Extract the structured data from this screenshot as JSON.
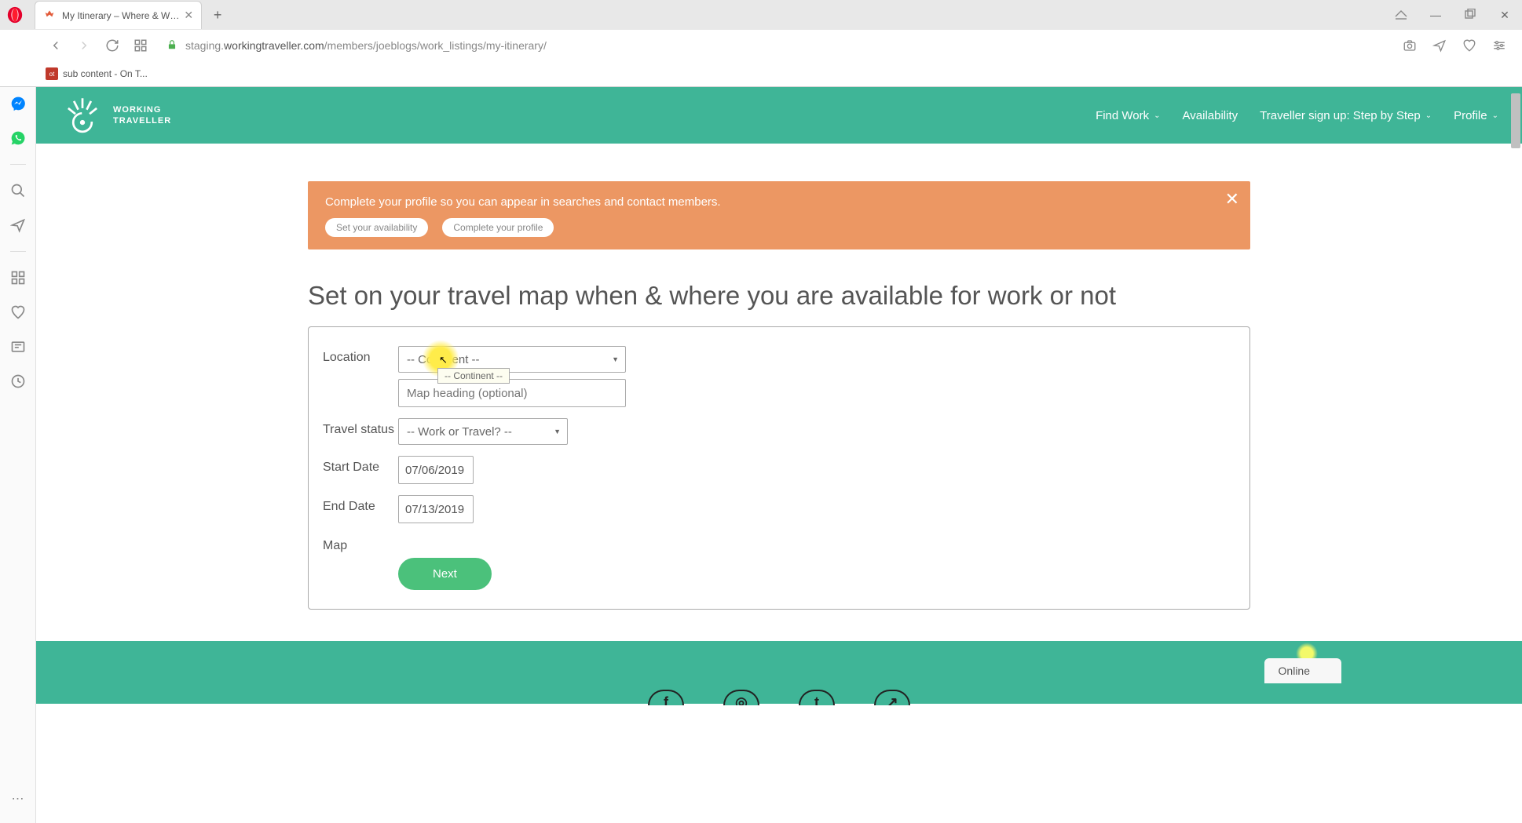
{
  "browser": {
    "tab_title": "My Itinerary – Where & W…",
    "url_prefix": "staging.",
    "url_host": "workingtraveller.com",
    "url_path": "/members/joeblogs/work_listings/my-itinerary/",
    "bookmark": "sub content - On T..."
  },
  "header": {
    "logo_line1": "WORKING",
    "logo_line2": "TRAVELLER",
    "nav": {
      "find_work": "Find Work",
      "availability": "Availability",
      "signup": "Traveller sign up: Step by Step",
      "profile": "Profile"
    }
  },
  "alert": {
    "text": "Complete your profile so you can appear in searches and contact members.",
    "btn1": "Set your availability",
    "btn2": "Complete your profile"
  },
  "heading": "Set on your travel map when & where you are available for work or not",
  "form": {
    "labels": {
      "location": "Location",
      "travel_status": "Travel status",
      "start_date": "Start Date",
      "end_date": "End Date",
      "map": "Map"
    },
    "continent_value": "-- Continent --",
    "continent_tooltip": "-- Continent --",
    "map_heading_placeholder": "Map heading (optional)",
    "travel_status_value": "-- Work or Travel? --",
    "start_date_value": "07/06/2019",
    "end_date_value": "07/13/2019",
    "next": "Next"
  },
  "footer": {
    "online": "Online"
  }
}
